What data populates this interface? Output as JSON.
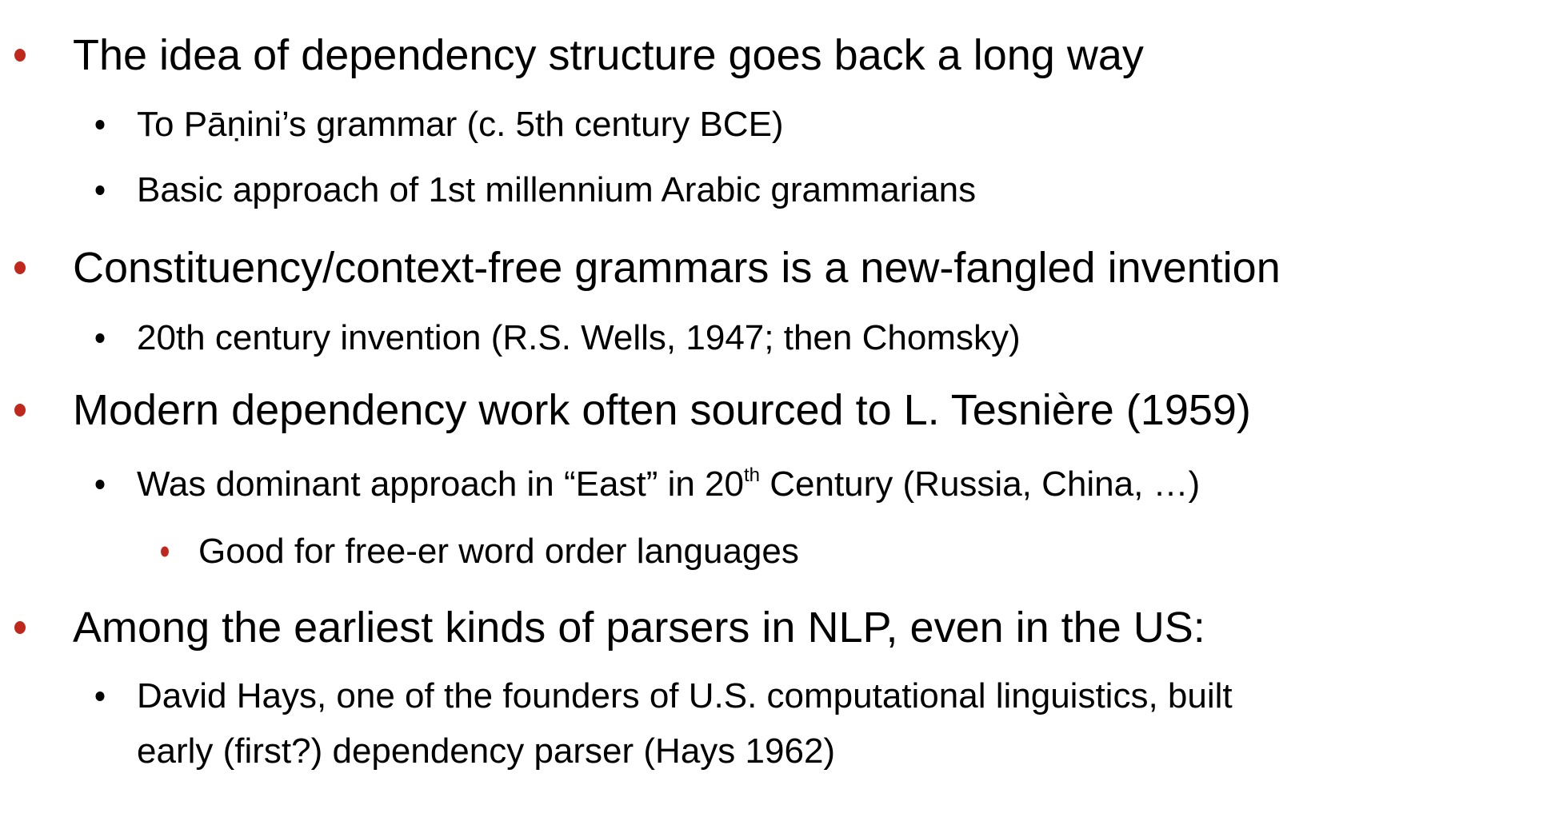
{
  "colors": {
    "accent_bullet": "#c0281e",
    "text": "#000000"
  },
  "bullets": [
    {
      "level": 1,
      "text": "The idea of dependency structure goes back a long way"
    },
    {
      "level": 2,
      "text": "To Pāṇini’s grammar (c. 5th century BCE)"
    },
    {
      "level": 2,
      "text": "Basic approach of 1st millennium Arabic grammarians"
    },
    {
      "level": 1,
      "text": "Constituency/context-free grammars is a new-fangled invention"
    },
    {
      "level": 2,
      "text": "20th century invention (R.S. Wells, 1947; then Chomsky)"
    },
    {
      "level": 1,
      "text": "Modern dependency work often sourced to L. Tesnière (1959)"
    },
    {
      "level": 2,
      "text_before": "Was dominant approach in “East” in 20",
      "sup": "th",
      "text_after": " Century (Russia, China, …)"
    },
    {
      "level": 3,
      "text": "Good for free-er word order languages"
    },
    {
      "level": 1,
      "text": "Among the earliest kinds of parsers in NLP, even in the US:"
    },
    {
      "level": 2,
      "text": "David Hays, one of the founders of U.S. computational linguistics, built",
      "continuation": "early (first?) dependency parser (Hays 1962)"
    }
  ]
}
